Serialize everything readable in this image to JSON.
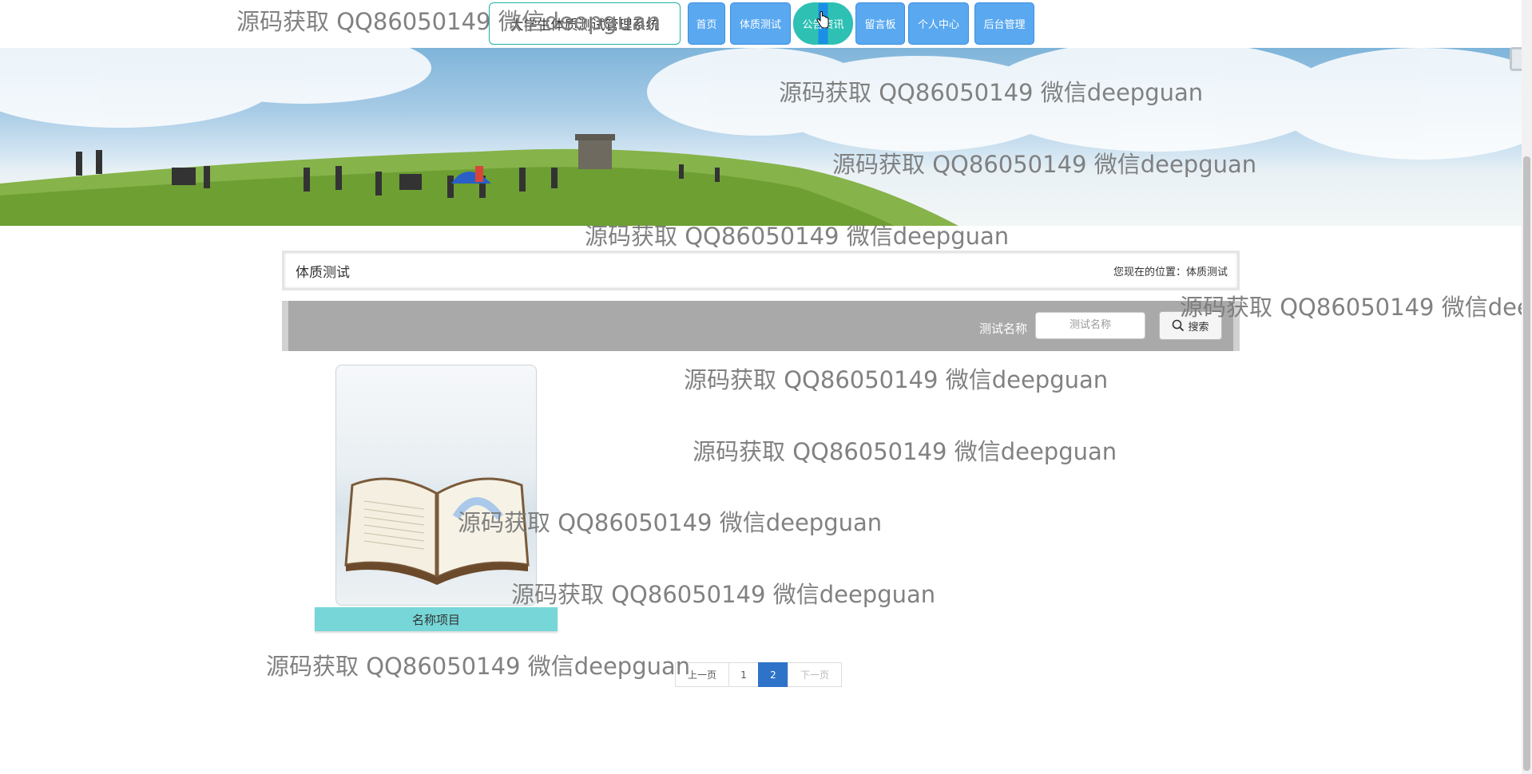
{
  "header": {
    "brand": "大学生体质测试管理系统",
    "nav": [
      {
        "label": "首页"
      },
      {
        "label": "体质测试"
      },
      {
        "label": "公告资讯"
      },
      {
        "label": "留言板"
      },
      {
        "label": "个人中心"
      },
      {
        "label": "后台管理"
      }
    ],
    "active_index": 2
  },
  "section": {
    "title": "体质测试",
    "breadcrumb": "您现在的位置：体质测试"
  },
  "search": {
    "label": "测试名称",
    "placeholder": "测试名称",
    "button_label": "搜索",
    "button_icon": "search-icon"
  },
  "items": [
    {
      "name": "名称项目"
    }
  ],
  "pagination": {
    "prev": "上一页",
    "pages": [
      "1",
      "2"
    ],
    "current": "2",
    "next": "下一页"
  },
  "watermark": "源码获取 QQ86050149 微信deepguan",
  "colors": {
    "nav_button": "#59a8f0",
    "nav_active": "#2fc0b4",
    "brand_border": "#19b3a4",
    "caption_bg": "#77d6d7",
    "page_current": "#2f73c9",
    "search_bar": "#a9a9a9"
  }
}
